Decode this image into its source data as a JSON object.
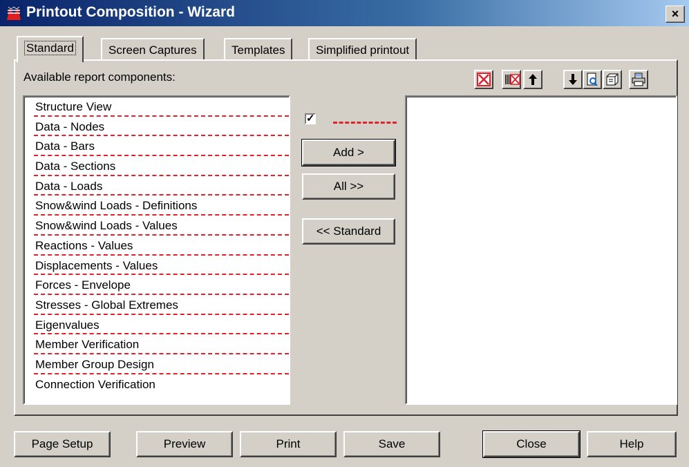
{
  "window": {
    "title": "Printout Composition - Wizard",
    "close_label": "×"
  },
  "tabs": [
    {
      "label": "Standard",
      "active": true
    },
    {
      "label": "Screen Captures",
      "active": false
    },
    {
      "label": "Templates",
      "active": false
    },
    {
      "label": "Simplified printout",
      "active": false
    }
  ],
  "available_label": "Available report components:",
  "components": [
    "Structure View",
    "Data - Nodes",
    "Data - Bars",
    "Data - Sections",
    "Data - Loads",
    "Snow&wind Loads - Definitions",
    "Snow&wind Loads - Values",
    "Reactions - Values",
    "Displacements - Values",
    "Forces - Envelope",
    "Stresses - Global Extremes",
    "Eigenvalues",
    "Member Verification",
    "Member Group Design",
    "Connection Verification"
  ],
  "separator_checkbox": {
    "checked": true,
    "mark": "✓"
  },
  "middle_buttons": {
    "add": "Add >",
    "all": "All >>",
    "standard": "<< Standard"
  },
  "toolbar_icons": [
    "delete-icon",
    "delete-all-icon",
    "move-up-icon",
    "move-down-icon",
    "preview-icon",
    "template-icon",
    "print-icon"
  ],
  "bottom_buttons": {
    "page_setup": "Page Setup",
    "preview": "Preview",
    "print": "Print",
    "save": "Save",
    "close": "Close",
    "help": "Help"
  },
  "colors": {
    "separator": "#e0202a",
    "titlebar": "#0a246a",
    "face": "#d4d0c8"
  }
}
